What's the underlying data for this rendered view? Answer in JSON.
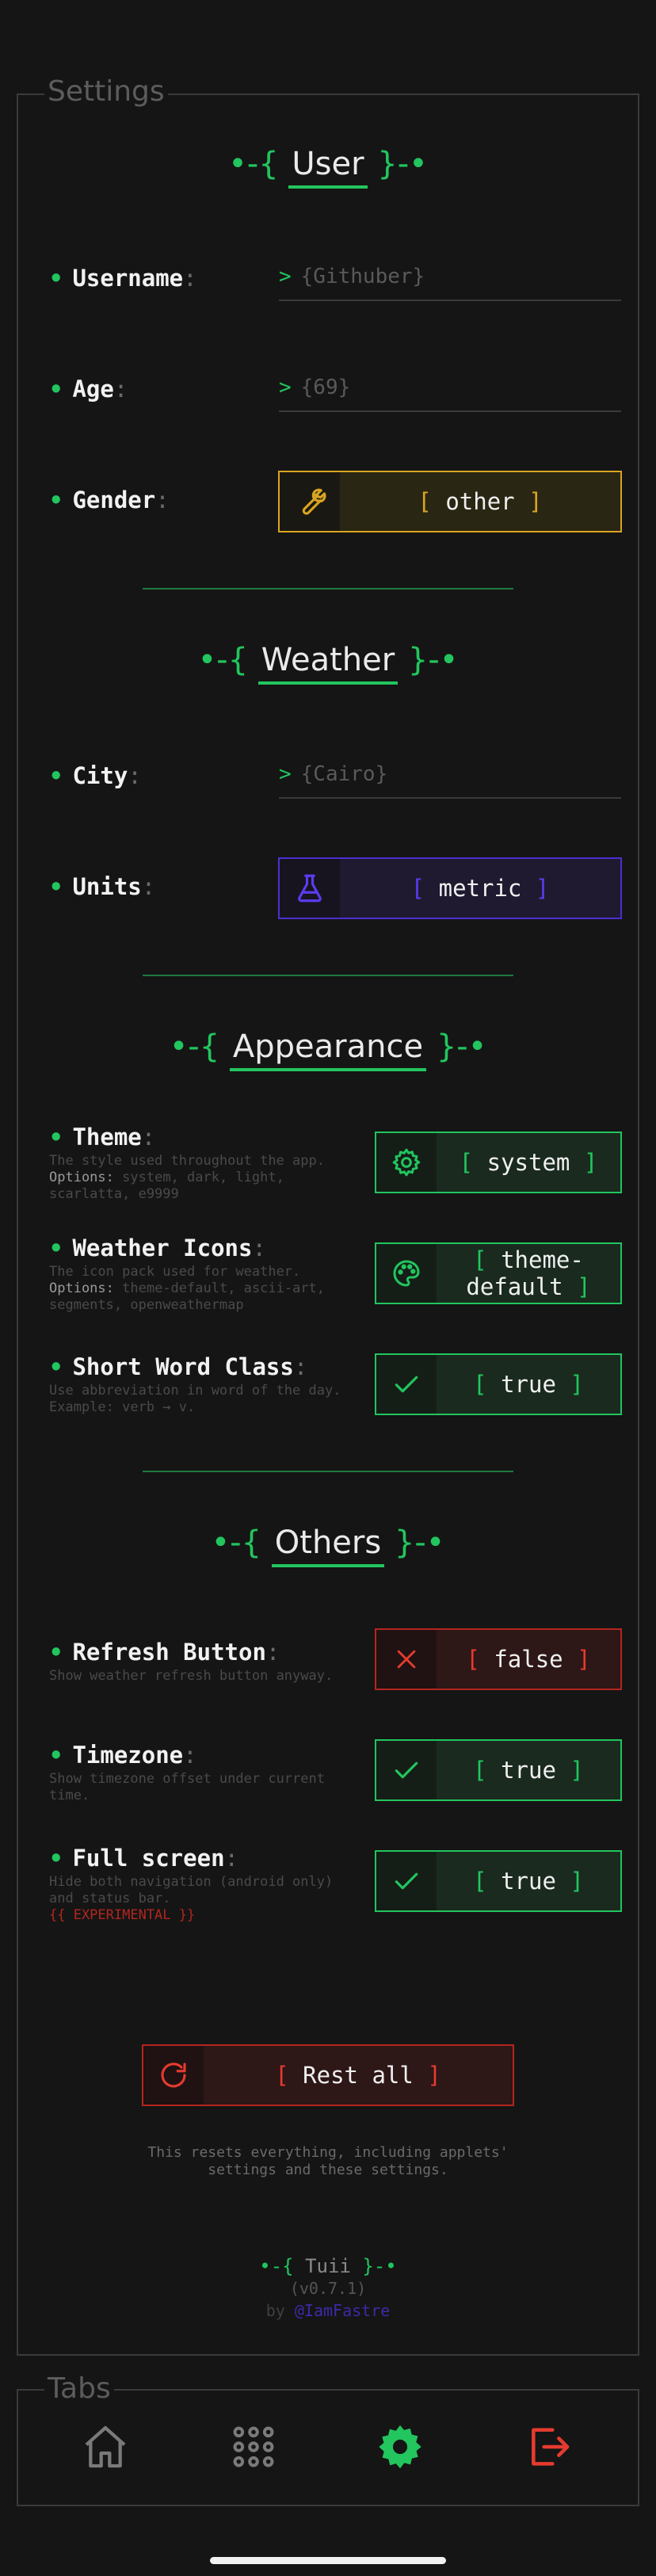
{
  "settings": {
    "legend": "Settings",
    "user": {
      "title_left": "•-{",
      "title": "User",
      "title_right": "}-•",
      "username": {
        "label": "Username",
        "placeholder": "{Githuber}"
      },
      "age": {
        "label": "Age",
        "placeholder": "{69}"
      },
      "gender": {
        "label": "Gender",
        "value": "other"
      }
    },
    "weather": {
      "title_left": "•-{",
      "title": "Weather",
      "title_right": "}-•",
      "city": {
        "label": "City",
        "placeholder": "{Cairo}"
      },
      "units": {
        "label": "Units",
        "value": "metric"
      }
    },
    "appearance": {
      "title_left": "•-{",
      "title": "Appearance",
      "title_right": "}-•",
      "theme": {
        "label": "Theme",
        "desc": "The style used throughout the app.",
        "options_key": "Options:",
        "options": "system, dark, light, scarlatta, e9999",
        "value": "system"
      },
      "weather_icons": {
        "label": "Weather Icons",
        "desc": "The icon pack used for weather.",
        "options_key": "Options:",
        "options": "theme-default, ascii-art, segments, openweathermap",
        "value_line1": "theme-",
        "value_line2": "default"
      },
      "short_word_class": {
        "label": "Short Word Class",
        "desc": "Use abbreviation in word of the day. Example: verb → v.",
        "value": "true"
      }
    },
    "others": {
      "title_left": "•-{",
      "title": "Others",
      "title_right": "}-•",
      "refresh_button": {
        "label": "Refresh Button",
        "desc": "Show weather refresh button anyway.",
        "value": "false"
      },
      "timezone": {
        "label": "Timezone",
        "desc": "Show timezone offset under current time.",
        "value": "true"
      },
      "full_screen": {
        "label": "Full screen",
        "desc": "Hide both navigation (android only) and status bar.",
        "warning": "{{ EXPERIMENTAL }}",
        "value": "true"
      }
    },
    "reset": {
      "label": "Rest all",
      "note_line1": "This resets everything, including applets'",
      "note_line2": "settings and these settings."
    },
    "footer": {
      "brand_left": "•-{",
      "brand": "Tuii",
      "brand_right": "}-•",
      "version": "(v0.7.1)",
      "by": "by",
      "author": "@IamFastre"
    }
  },
  "tabs": {
    "legend": "Tabs",
    "items": [
      {
        "icon": "home-icon",
        "active": false
      },
      {
        "icon": "apps-grid-icon",
        "active": false
      },
      {
        "icon": "settings-gear-icon",
        "active": true
      },
      {
        "icon": "logout-icon",
        "active": false
      }
    ]
  },
  "colors": {
    "background": "#151515",
    "accent_green": "#22c55e",
    "accent_yellow": "#d9a520",
    "accent_purple": "#4c2fd1",
    "accent_red": "#b3261e",
    "muted": "#5c5c5c"
  }
}
